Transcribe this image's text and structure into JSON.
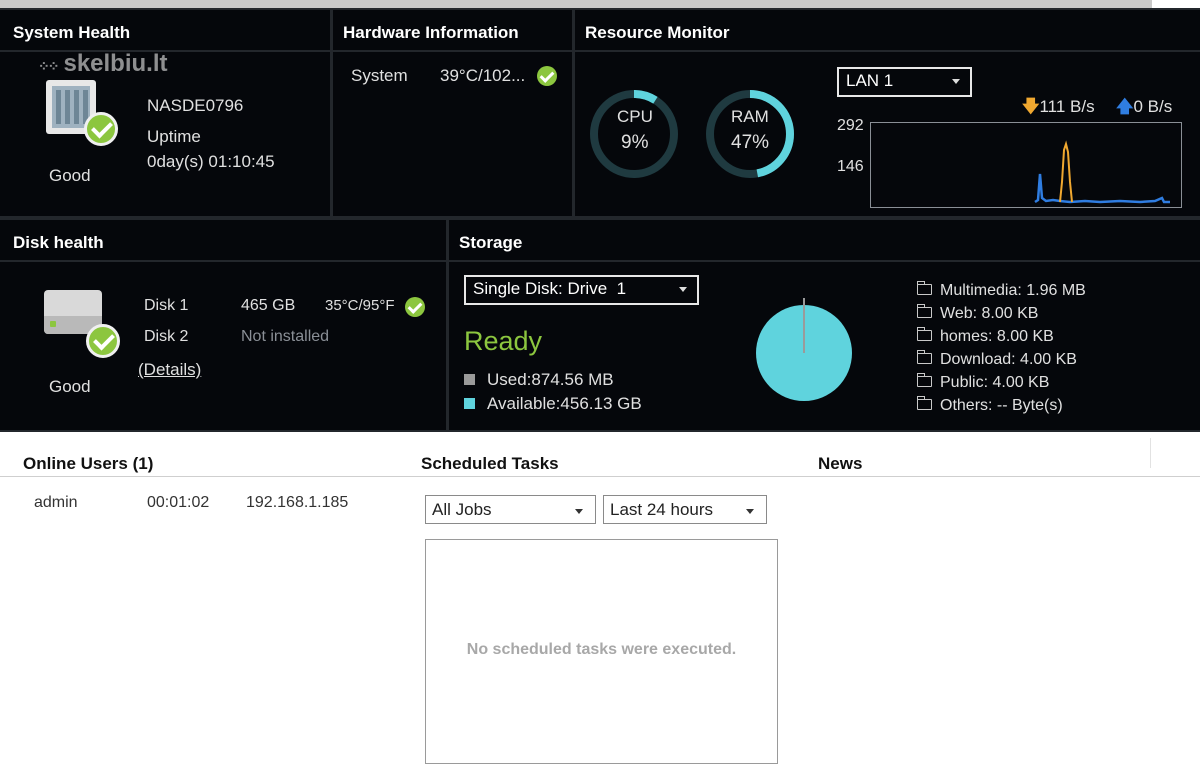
{
  "watermark": "skelbiu.lt",
  "system_health": {
    "title": "System Health",
    "device_name": "NASDE0796",
    "uptime_label": "Uptime",
    "uptime_value": "0day(s) 01:10:45",
    "status": "Good"
  },
  "hardware_info": {
    "title": "Hardware Information",
    "row_label": "System",
    "row_value": "39°C/102..."
  },
  "resource_monitor": {
    "title": "Resource Monitor",
    "cpu_label": "CPU",
    "cpu_value": "9%",
    "cpu_percent": 9,
    "ram_label": "RAM",
    "ram_value": "47%",
    "ram_percent": 47,
    "interface": "LAN 1",
    "download_rate": "111 B/s",
    "upload_rate": "0 B/s",
    "y_ticks": [
      "292",
      "146"
    ],
    "download_color": "#f0a830",
    "upload_color": "#2f7de1"
  },
  "disk_health": {
    "title": "Disk health",
    "disks": [
      {
        "name": "Disk 1",
        "size": "465 GB",
        "temp": "35°C/95°F"
      },
      {
        "name": "Disk 2",
        "status": "Not installed"
      }
    ],
    "details_link": "(Details)",
    "status": "Good"
  },
  "storage": {
    "title": "Storage",
    "volume": "Single Disk: Drive  1",
    "status": "Ready",
    "used": "Used:874.56 MB",
    "available": "Available:456.13 GB",
    "used_color": "#9a9a9a",
    "available_color": "#5fd3dd",
    "folders": [
      "Multimedia: 1.96 MB",
      "Web: 8.00 KB",
      "homes: 8.00 KB",
      "Download: 4.00 KB",
      "Public: 4.00 KB",
      "Others: -- Byte(s)"
    ]
  },
  "online_users": {
    "title": "Online Users (1)",
    "users": [
      {
        "name": "admin",
        "time": "00:01:02",
        "ip": "192.168.1.185"
      }
    ]
  },
  "scheduled_tasks": {
    "title": "Scheduled Tasks",
    "filter_jobs": "All Jobs",
    "filter_time": "Last 24 hours",
    "empty_message": "No scheduled tasks were executed."
  },
  "news": {
    "title": "News"
  },
  "colors": {
    "good_green": "#8cc63f",
    "gauge_teal": "#5fd3dd"
  }
}
